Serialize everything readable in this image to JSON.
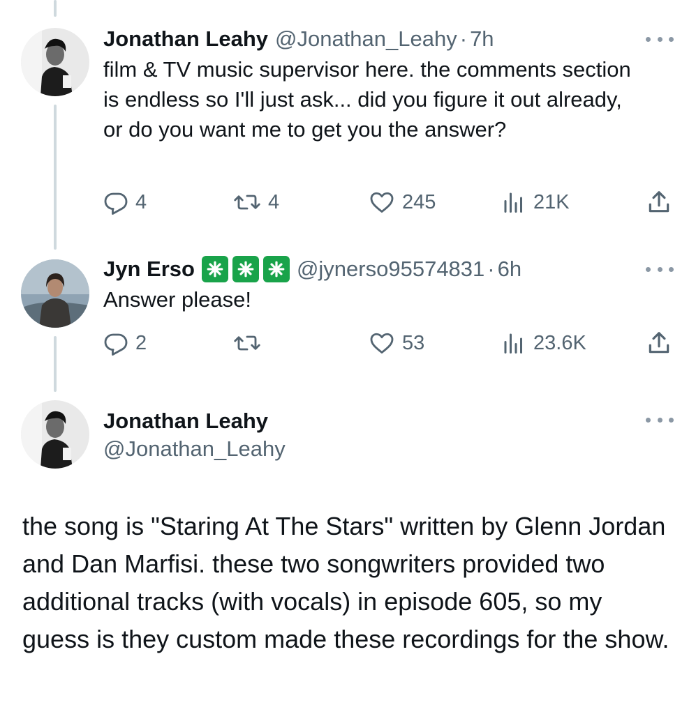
{
  "tweets": [
    {
      "name": "Jonathan Leahy",
      "handle": "@Jonathan_Leahy",
      "separator": "·",
      "time": "7h",
      "text": "film & TV music supervisor here. the comments section is endless so I'll just ask... did you figure it out already, or do you want me to get you the answer?",
      "replies": "4",
      "retweets": "4",
      "likes": "245",
      "views": "21K"
    },
    {
      "name": "Jyn Erso",
      "badge_icon": "sparkle-icon",
      "badge_color": "#19a34a",
      "handle": "@jynerso95574831",
      "separator": "·",
      "time": "6h",
      "text": "Answer please!",
      "replies": "2",
      "retweets": "",
      "likes": "53",
      "views": "23.6K"
    }
  ],
  "main_tweet": {
    "name": "Jonathan Leahy",
    "handle": "@Jonathan_Leahy",
    "text": "the song is \"Staring At The Stars\" written by Glenn Jordan and Dan Marfisi. these two songwriters provided two additional tracks (with vocals) in episode 605, so my guess is they custom made these recordings for the show."
  },
  "colors": {
    "secondary_text": "#536471",
    "thread_line": "#cfd9de",
    "verified_badge": "#19a34a"
  }
}
